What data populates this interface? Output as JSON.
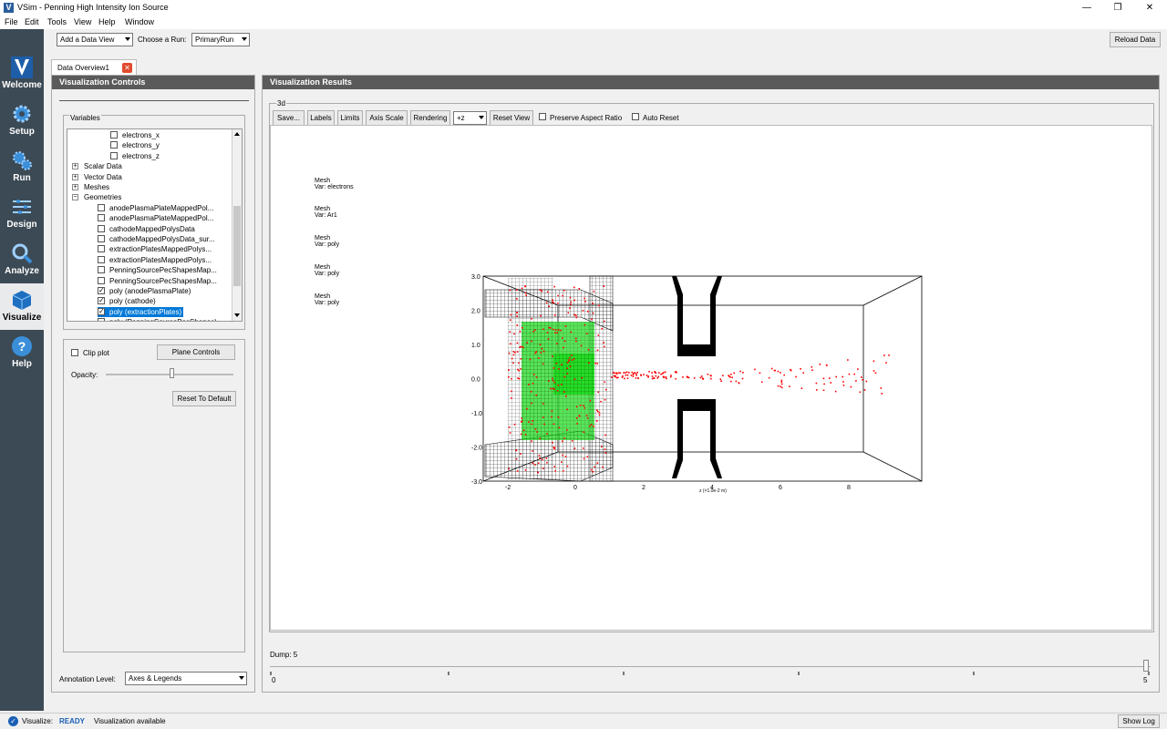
{
  "window": {
    "title": "VSim - Penning High Intensity Ion Source",
    "logo": "V",
    "minimize_icon": "minimize-icon",
    "restore_icon": "restore-icon",
    "close_icon": "close-icon"
  },
  "menu": [
    "File",
    "Edit",
    "Tools",
    "View",
    "Help",
    "Window"
  ],
  "nav": [
    {
      "label": "Welcome",
      "icon": "vsim-logo-icon"
    },
    {
      "label": "Setup",
      "icon": "gear-icon"
    },
    {
      "label": "Run",
      "icon": "gears-icon"
    },
    {
      "label": "Design",
      "icon": "design-icon"
    },
    {
      "label": "Analyze",
      "icon": "magnifier-icon"
    },
    {
      "label": "Visualize",
      "icon": "cube-icon"
    },
    {
      "label": "Help",
      "icon": "help-icon"
    }
  ],
  "toolbar": {
    "data_view": "Add a Data View",
    "choose_run_label": "Choose a Run:",
    "run": "PrimaryRun",
    "reload": "Reload Data"
  },
  "tab": {
    "label": "Data Overview1"
  },
  "controls": {
    "header": "Visualization Controls",
    "variables_label": "Variables",
    "tree": [
      {
        "label": "electrons_x",
        "checked": false,
        "level": 2
      },
      {
        "label": "electrons_y",
        "checked": false,
        "level": 2
      },
      {
        "label": "electrons_z",
        "checked": false,
        "level": 2
      },
      {
        "label": "Scalar Data",
        "expand": "+",
        "level": 0
      },
      {
        "label": "Vector Data",
        "expand": "+",
        "level": 0
      },
      {
        "label": "Meshes",
        "expand": "+",
        "level": 0
      },
      {
        "label": "Geometries",
        "expand": "−",
        "level": 0
      },
      {
        "label": "anodePlasmaPlateMappedPol...",
        "checked": false,
        "level": 1
      },
      {
        "label": "anodePlasmaPlateMappedPol...",
        "checked": false,
        "level": 1
      },
      {
        "label": "cathodeMappedPolysData",
        "checked": false,
        "level": 1
      },
      {
        "label": "cathodeMappedPolysData_sur...",
        "checked": false,
        "level": 1
      },
      {
        "label": "extractionPlatesMappedPolys...",
        "checked": false,
        "level": 1
      },
      {
        "label": "extractionPlatesMappedPolys...",
        "checked": false,
        "level": 1
      },
      {
        "label": "PenningSourcePecShapesMap...",
        "checked": false,
        "level": 1
      },
      {
        "label": "PenningSourcePecShapesMap...",
        "checked": false,
        "level": 1
      },
      {
        "label": "poly (anodePlasmaPlate)",
        "checked": true,
        "level": 1
      },
      {
        "label": "poly (cathode)",
        "checked": true,
        "level": 1
      },
      {
        "label": "poly (extractionPlates)",
        "checked": true,
        "level": 1,
        "selected": true
      },
      {
        "label": "poly (PenningSourcePecShapes)",
        "checked": false,
        "level": 1
      }
    ],
    "clip_plot": "Clip plot",
    "plane_controls": "Plane Controls",
    "opacity": "Opacity:",
    "reset_default": "Reset To Default",
    "annotation_label": "Annotation Level:",
    "annotation_value": "Axes & Legends"
  },
  "results": {
    "header": "Visualization Results",
    "group": "3d",
    "buttons": [
      "Save...",
      "Labels",
      "Limits",
      "Axis Scale",
      "Rendering"
    ],
    "view_axis": "+z",
    "reset_view": "Reset View",
    "preserve_aspect": "Preserve Aspect Ratio",
    "auto_reset": "Auto Reset",
    "legends": [
      {
        "mesh": "Mesh",
        "var": "Var: electrons"
      },
      {
        "mesh": "Mesh",
        "var": "Var: Ar1"
      },
      {
        "mesh": "Mesh",
        "var": "Var: poly"
      },
      {
        "mesh": "Mesh",
        "var": "Var: poly"
      },
      {
        "mesh": "Mesh",
        "var": "Var: poly"
      }
    ],
    "y_ticks": [
      "3.0",
      "2.0",
      "1.0",
      "0.0",
      "-1.0",
      "-2.0",
      "-3.0"
    ],
    "x_ticks": [
      "-2",
      "0",
      "2",
      "4",
      "6",
      "8"
    ],
    "x_axis_label": "z (×1.0e-2 m)",
    "dump_label": "Dump: 5",
    "slider_min": "0",
    "slider_max": "5",
    "dump_value": 5
  },
  "status": {
    "label": "Visualize:",
    "state": "READY",
    "message": "Visualization available",
    "show_log": "Show Log",
    "state_color": "#1a5fb4"
  }
}
